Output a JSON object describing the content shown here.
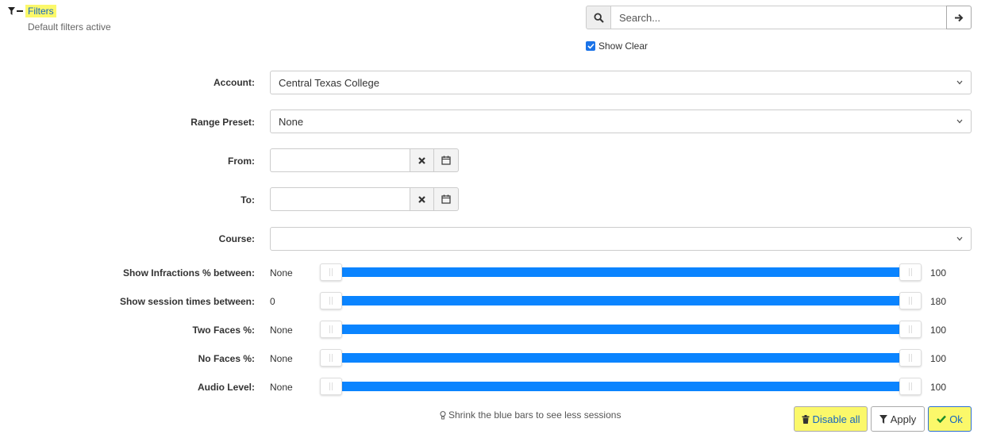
{
  "header": {
    "title": "Filters",
    "subtitle": "Default filters active"
  },
  "search": {
    "placeholder": "Search...",
    "value": ""
  },
  "show_clear": {
    "label": "Show Clear",
    "checked": true
  },
  "fields": {
    "account": {
      "label": "Account:",
      "value": "Central Texas College"
    },
    "range_preset": {
      "label": "Range Preset:",
      "value": "None"
    },
    "from": {
      "label": "From:",
      "value": ""
    },
    "to": {
      "label": "To:",
      "value": ""
    },
    "course": {
      "label": "Course:",
      "value": ""
    }
  },
  "sliders": [
    {
      "label": "Show Infractions % between:",
      "min_label": "None",
      "max_label": "100",
      "range_low": 0,
      "range_high": 100
    },
    {
      "label": "Show session times between:",
      "min_label": "0",
      "max_label": "180",
      "range_low": 0,
      "range_high": 100
    },
    {
      "label": "Two Faces %:",
      "min_label": "None",
      "max_label": "100",
      "range_low": 0,
      "range_high": 100
    },
    {
      "label": "No Faces %:",
      "min_label": "None",
      "max_label": "100",
      "range_low": 0,
      "range_high": 100
    },
    {
      "label": "Audio Level:",
      "min_label": "None",
      "max_label": "100",
      "range_low": 0,
      "range_high": 100
    }
  ],
  "hint": "Shrink the blue bars to see less sessions",
  "buttons": {
    "disable_all": "Disable all",
    "apply": "Apply",
    "ok": "Ok"
  },
  "colors": {
    "accent": "#1565c0",
    "slider": "#0a84ff",
    "highlight": "#fbf86a"
  }
}
